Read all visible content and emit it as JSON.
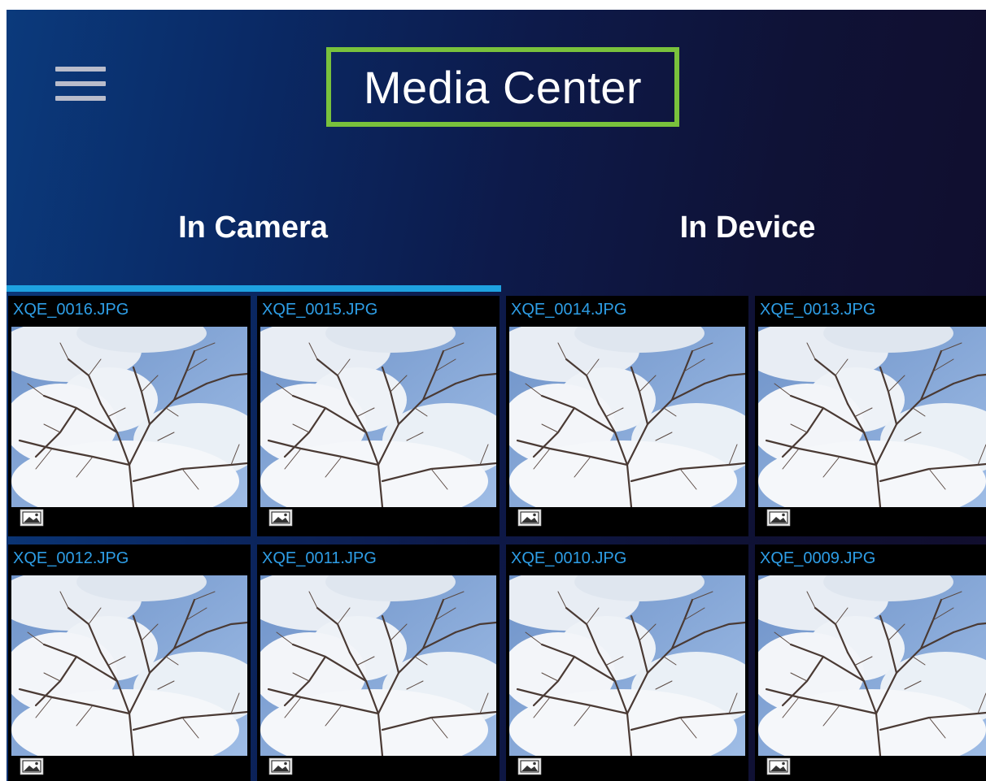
{
  "header": {
    "menu_icon": "hamburger-menu-icon",
    "title": "Media Center",
    "highlight_color": "#79c23c"
  },
  "tabs": [
    {
      "label": "In Camera",
      "selected": true
    },
    {
      "label": "In Device",
      "selected": false
    }
  ],
  "accent_color": "#1ea2e0",
  "media": [
    {
      "name": "XQE_0016.JPG",
      "type_icon": "image-icon"
    },
    {
      "name": "XQE_0015.JPG",
      "type_icon": "image-icon"
    },
    {
      "name": "XQE_0014.JPG",
      "type_icon": "image-icon"
    },
    {
      "name": "XQE_0013.JPG",
      "type_icon": "image-icon"
    },
    {
      "name": "XQE_0012.JPG",
      "type_icon": "image-icon"
    },
    {
      "name": "XQE_0011.JPG",
      "type_icon": "image-icon"
    },
    {
      "name": "XQE_0010.JPG",
      "type_icon": "image-icon"
    },
    {
      "name": "XQE_0009.JPG",
      "type_icon": "image-icon"
    }
  ]
}
